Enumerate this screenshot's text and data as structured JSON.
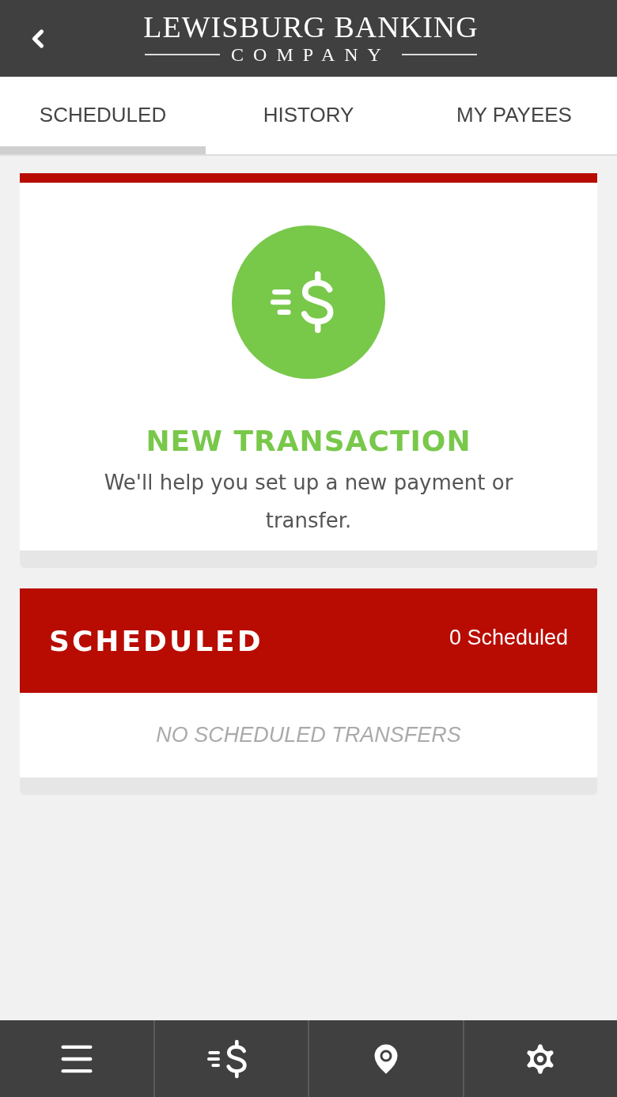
{
  "header": {
    "logo_line_1": "LEWISBURG BANKING",
    "logo_line_2": "COMPANY"
  },
  "tabs": [
    {
      "label": "SCHEDULED",
      "selected": true
    },
    {
      "label": "HISTORY",
      "selected": false
    },
    {
      "label": "MY PAYEES",
      "selected": false
    }
  ],
  "new_transaction": {
    "title": "NEW TRANSACTION",
    "description": "We'll help you set up a new payment or transfer."
  },
  "scheduled": {
    "title": "SCHEDULED",
    "count": "0 Scheduled",
    "empty_message": "NO SCHEDULED TRANSFERS"
  },
  "bottom_nav": [
    {
      "kind": "menu",
      "selected": false
    },
    {
      "kind": "transfer",
      "selected": false
    },
    {
      "kind": "location",
      "selected": false
    },
    {
      "kind": "settings",
      "selected": false
    }
  ]
}
